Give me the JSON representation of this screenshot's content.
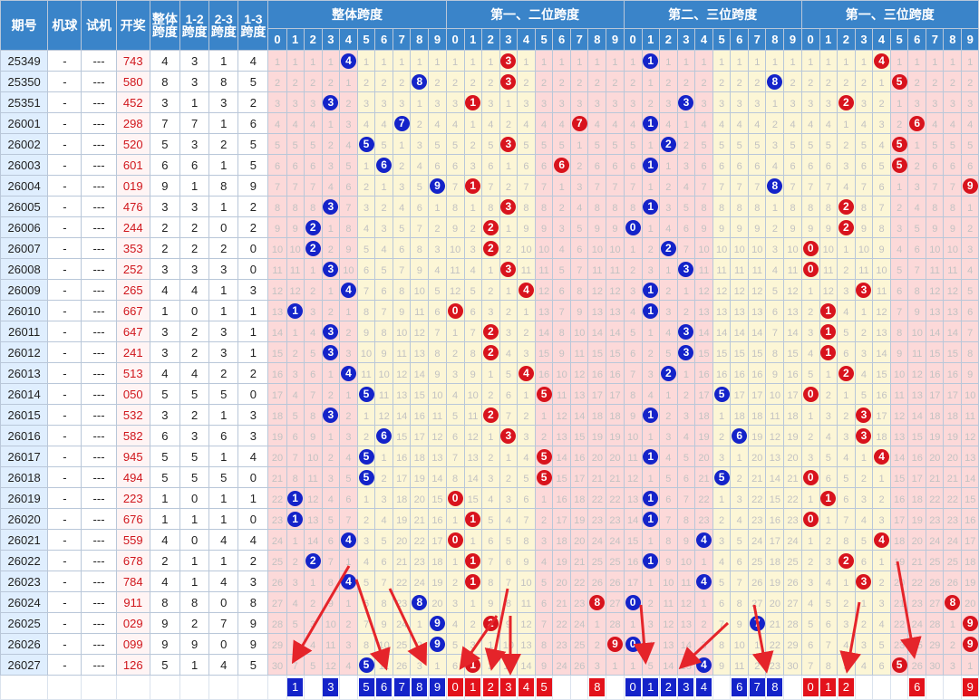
{
  "header": {
    "period": "期号",
    "machine": "机球",
    "trial": "试机",
    "draw": "开奖",
    "span_total": "整体\n跨度",
    "span_12": "1-2\n跨度",
    "span_23": "2-3\n跨度",
    "span_13": "1-3\n跨度",
    "group_total": "整体跨度",
    "group_12": "第一、二位跨度",
    "group_23": "第二、三位跨度",
    "group_13": "第一、三位跨度",
    "digits": [
      "0",
      "1",
      "2",
      "3",
      "4",
      "5",
      "6",
      "7",
      "8",
      "9"
    ]
  },
  "row_dash": "-",
  "row_trial": "---",
  "colors": {
    "header_bg": "#3a84c9",
    "blue_ball": "#1423c9",
    "red_ball": "#d8131d",
    "pink_zone": "#fcd9d9",
    "yellow_zone": "#fcf6d6",
    "draw_red": "#d0161c"
  },
  "chart_data": {
    "type": "table",
    "title": "",
    "columns": [
      "期号",
      "机球",
      "试机",
      "开奖",
      "整体跨度",
      "1-2跨度",
      "2-3跨度",
      "1-3跨度"
    ],
    "rows": [
      {
        "period": "25349",
        "draw": "743",
        "spans": [
          4,
          3,
          1,
          4
        ]
      },
      {
        "period": "25350",
        "draw": "580",
        "spans": [
          8,
          3,
          8,
          5
        ]
      },
      {
        "period": "25351",
        "draw": "452",
        "spans": [
          3,
          1,
          3,
          2
        ]
      },
      {
        "period": "26001",
        "draw": "298",
        "spans": [
          7,
          7,
          1,
          6
        ]
      },
      {
        "period": "26002",
        "draw": "520",
        "spans": [
          5,
          3,
          2,
          5
        ]
      },
      {
        "period": "26003",
        "draw": "601",
        "spans": [
          6,
          6,
          1,
          5
        ]
      },
      {
        "period": "26004",
        "draw": "019",
        "spans": [
          9,
          1,
          8,
          9
        ]
      },
      {
        "period": "26005",
        "draw": "476",
        "spans": [
          3,
          3,
          1,
          2
        ]
      },
      {
        "period": "26006",
        "draw": "244",
        "spans": [
          2,
          2,
          0,
          2
        ]
      },
      {
        "period": "26007",
        "draw": "353",
        "spans": [
          2,
          2,
          2,
          0
        ]
      },
      {
        "period": "26008",
        "draw": "252",
        "spans": [
          3,
          3,
          3,
          0
        ]
      },
      {
        "period": "26009",
        "draw": "265",
        "spans": [
          4,
          4,
          1,
          3
        ]
      },
      {
        "period": "26010",
        "draw": "667",
        "spans": [
          1,
          0,
          1,
          1
        ]
      },
      {
        "period": "26011",
        "draw": "647",
        "spans": [
          3,
          2,
          3,
          1
        ]
      },
      {
        "period": "26012",
        "draw": "241",
        "spans": [
          3,
          2,
          3,
          1
        ]
      },
      {
        "period": "26013",
        "draw": "513",
        "spans": [
          4,
          4,
          2,
          2
        ]
      },
      {
        "period": "26014",
        "draw": "050",
        "spans": [
          5,
          5,
          5,
          0
        ]
      },
      {
        "period": "26015",
        "draw": "532",
        "spans": [
          3,
          2,
          1,
          3
        ]
      },
      {
        "period": "26016",
        "draw": "582",
        "spans": [
          6,
          3,
          6,
          3
        ]
      },
      {
        "period": "26017",
        "draw": "945",
        "spans": [
          5,
          5,
          1,
          4
        ]
      },
      {
        "period": "26018",
        "draw": "494",
        "spans": [
          5,
          5,
          5,
          0
        ]
      },
      {
        "period": "26019",
        "draw": "223",
        "spans": [
          1,
          0,
          1,
          1
        ]
      },
      {
        "period": "26020",
        "draw": "676",
        "spans": [
          1,
          1,
          1,
          0
        ]
      },
      {
        "period": "26021",
        "draw": "559",
        "spans": [
          4,
          0,
          4,
          4
        ]
      },
      {
        "period": "26022",
        "draw": "678",
        "spans": [
          2,
          1,
          1,
          2
        ]
      },
      {
        "period": "26023",
        "draw": "784",
        "spans": [
          4,
          1,
          4,
          3
        ]
      },
      {
        "period": "26024",
        "draw": "911",
        "spans": [
          8,
          8,
          0,
          8
        ]
      },
      {
        "period": "26025",
        "draw": "029",
        "spans": [
          9,
          2,
          7,
          9
        ]
      },
      {
        "period": "26026",
        "draw": "099",
        "spans": [
          9,
          9,
          0,
          9
        ]
      },
      {
        "period": "26027",
        "draw": "126",
        "spans": [
          5,
          1,
          4,
          5
        ]
      }
    ],
    "summary_highlights": {
      "span_total": [
        "1",
        "3",
        "5",
        "6",
        "7",
        "8",
        "9"
      ],
      "span_12": [
        "0",
        "1",
        "2",
        "3",
        "4",
        "5",
        "8"
      ],
      "span_23": [
        "0",
        "1",
        "2",
        "3",
        "4",
        "6",
        "7",
        "8"
      ],
      "span_13": [
        "0",
        "1",
        "2",
        "6",
        "9"
      ]
    }
  }
}
